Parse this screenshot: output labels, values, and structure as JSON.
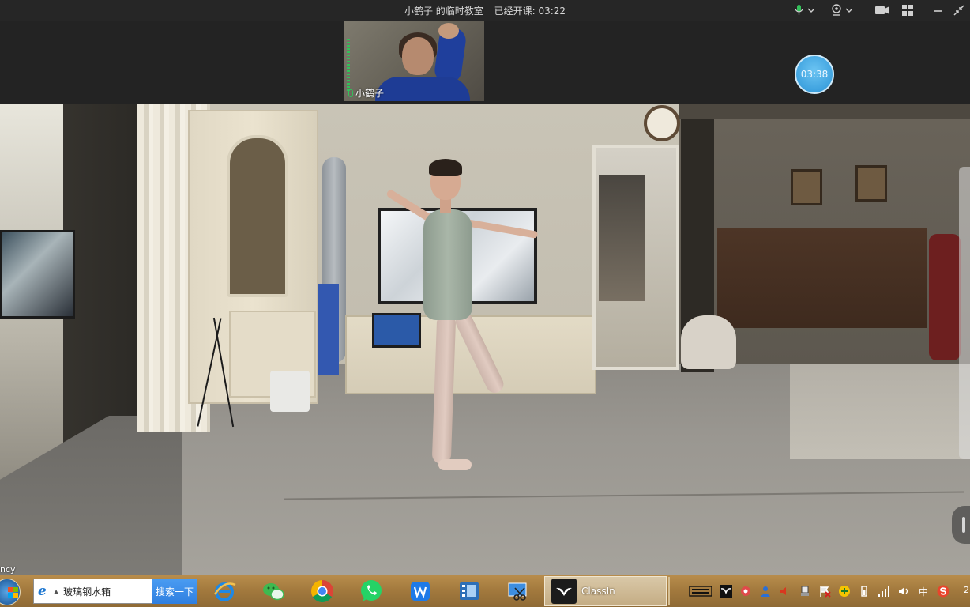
{
  "window": {
    "title_classroom": "小鹤子 的临时教室",
    "title_elapsed_label": "已经开课:",
    "title_elapsed_value": "03:22"
  },
  "titlebar_controls": [
    {
      "name": "microphone-dropdown",
      "icon": "microphone-icon"
    },
    {
      "name": "camera-dropdown",
      "icon": "webcam-icon"
    },
    {
      "name": "video-toggle",
      "icon": "video-camera-icon"
    },
    {
      "name": "layout-toggle",
      "icon": "grid-icon"
    },
    {
      "name": "minimize",
      "icon": "minimize-icon"
    },
    {
      "name": "exit-fullscreen",
      "icon": "shrink-icon"
    }
  ],
  "teacher_video": {
    "name": "小鹤子"
  },
  "timer": {
    "value": "03:38"
  },
  "video": {
    "overlay_text": "ncy"
  },
  "taskbar": {
    "search_text": "玻璃钢水箱",
    "search_button": "搜索一下",
    "apps": [
      {
        "name": "internet-explorer",
        "icon": "ie-icon"
      },
      {
        "name": "wechat",
        "icon": "wechat-icon"
      },
      {
        "name": "chrome",
        "icon": "chrome-icon"
      },
      {
        "name": "whatsapp",
        "icon": "whatsapp-icon"
      },
      {
        "name": "wps",
        "icon": "wps-icon"
      },
      {
        "name": "video-editor",
        "icon": "film-icon"
      },
      {
        "name": "screenshot-tool",
        "icon": "scissors-icon"
      }
    ],
    "active_app_label": "ClassIn",
    "tray_ime": "中",
    "clock_partial": "2"
  },
  "colors": {
    "titlebar_bg": "#262626",
    "timer_blue": "#3ea2df",
    "taskbar_bg": "#a37a3e",
    "mic_green": "#33c05a"
  }
}
